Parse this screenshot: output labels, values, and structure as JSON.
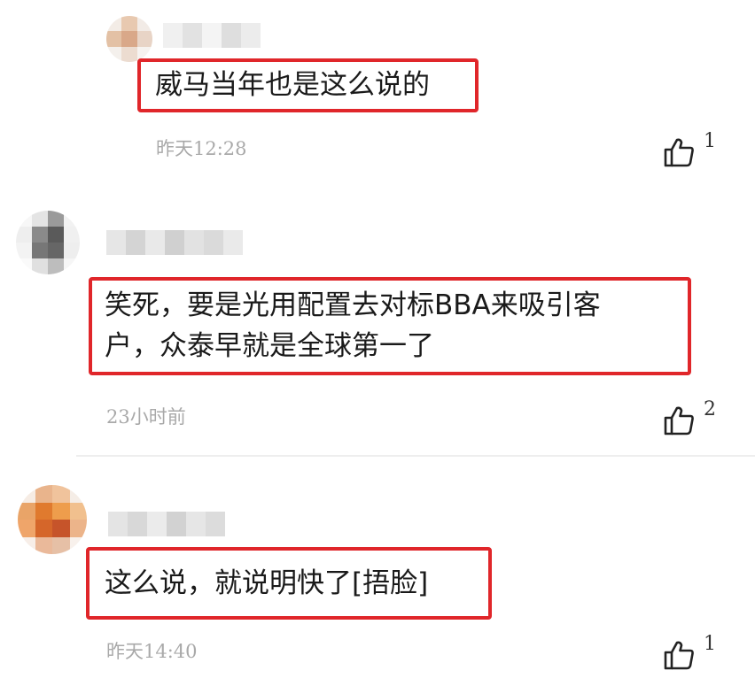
{
  "comments": [
    {
      "text": "威马当年也是这么说的",
      "time": "昨天12:28",
      "likes": "1",
      "avatar_icon": "blurred-avatar",
      "username_blurred": true
    },
    {
      "text": "笑死，要是光用配置去对标BBA来吸引客\n户，众泰早就是全球第一了",
      "time": "23小时前",
      "likes": "2",
      "avatar_icon": "blurred-avatar",
      "username_blurred": true
    },
    {
      "text": "这么说，就说明快了[捂脸]",
      "time": "昨天14:40",
      "likes": "1",
      "avatar_icon": "blurred-avatar",
      "username_blurred": true
    }
  ],
  "colors": {
    "highlight_border": "#e0262a",
    "timestamp": "#a9a9a9",
    "divider": "#eeeeee"
  },
  "icons": {
    "like": "thumbs-up-outline-icon"
  }
}
